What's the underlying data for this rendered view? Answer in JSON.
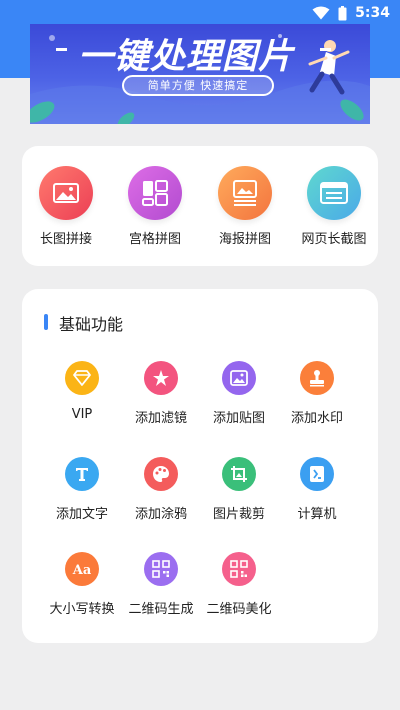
{
  "status_bar": {
    "time": "5:34",
    "wifi_icon": "wifi-icon",
    "battery_icon": "battery-icon"
  },
  "banner": {
    "title": "一键处理图片",
    "subtitle": "简单方便 快速搞定"
  },
  "top_tools": [
    {
      "label": "长图拼接",
      "icon": "image-icon",
      "color": "#f2585a"
    },
    {
      "label": "宫格拼图",
      "icon": "grid-icon",
      "color": "#cb5ad6"
    },
    {
      "label": "海报拼图",
      "icon": "poster-icon",
      "color": "#f9884a"
    },
    {
      "label": "网页长截图",
      "icon": "webpage-icon",
      "color": "#4fc9c9"
    }
  ],
  "basic_section": {
    "title": "基础功能",
    "items": [
      {
        "label": "VIP",
        "icon": "vip-diamond-icon",
        "color": "#fbb416"
      },
      {
        "label": "添加滤镜",
        "icon": "filter-icon",
        "color": "#f3547f"
      },
      {
        "label": "添加贴图",
        "icon": "sticker-icon",
        "color": "#9466ee"
      },
      {
        "label": "添加水印",
        "icon": "stamp-icon",
        "color": "#fb7f3a"
      },
      {
        "label": "添加文字",
        "icon": "text-icon",
        "color": "#3aa8f1"
      },
      {
        "label": "添加涂鸦",
        "icon": "palette-icon",
        "color": "#f45c5c"
      },
      {
        "label": "图片裁剪",
        "icon": "crop-icon",
        "color": "#3abf7a"
      },
      {
        "label": "计算机",
        "icon": "calculator-icon",
        "color": "#3b9ff1"
      },
      {
        "label": "大小写转换",
        "icon": "case-convert-icon",
        "color": "#fb7a3a"
      },
      {
        "label": "二维码生成",
        "icon": "qrcode-icon",
        "color": "#9b6ef0"
      },
      {
        "label": "二维码美化",
        "icon": "qrcode-beautify-icon",
        "color": "#f5608c"
      }
    ]
  }
}
